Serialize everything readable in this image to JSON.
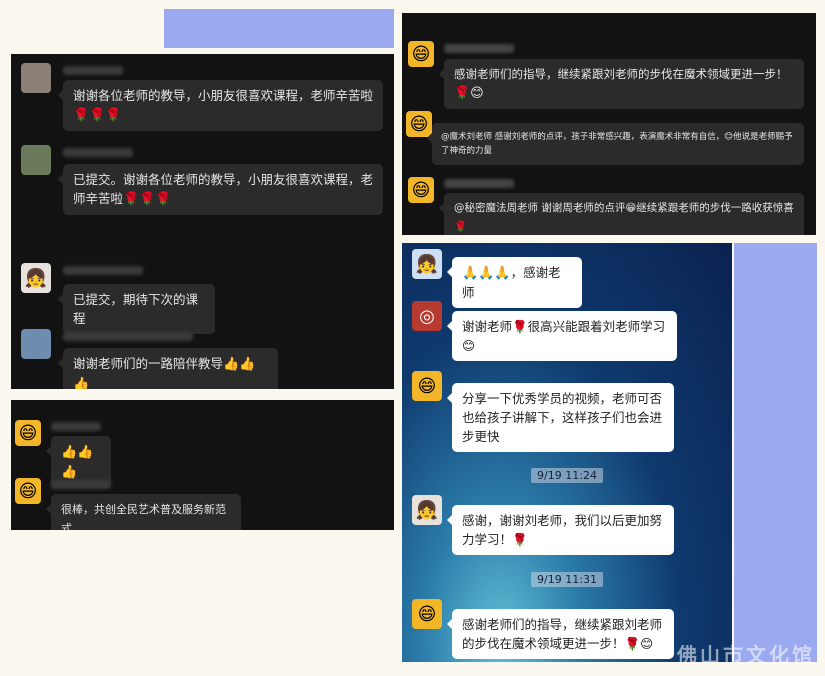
{
  "icons": {
    "rose": "🌹",
    "thumb": "👍",
    "smile": "😊",
    "grin": "😁",
    "clap": "🙏",
    "person": "👧",
    "cartoon": "😄"
  },
  "panel1": {
    "messages": [
      {
        "text": "谢谢各位老师的教导，小朋友很喜欢课程，老师辛苦啦",
        "emoji": "🌹🌹🌹"
      },
      {
        "text": "已提交。谢谢各位老师的教导，小朋友很喜欢课程，老师辛苦啦",
        "emoji": "🌹🌹🌹"
      },
      {
        "text": "已提交，期待下次的课程",
        "emoji": ""
      },
      {
        "text": "谢谢老师们的一路陪伴教导",
        "emoji": "👍👍👍"
      }
    ]
  },
  "panel2": {
    "messages": [
      {
        "text": "",
        "emoji": "👍👍👍"
      },
      {
        "text": "很棒，共创全民艺术普及服务新范式",
        "emoji": ""
      }
    ]
  },
  "panel3": {
    "messages": [
      {
        "text": "感谢老师们的指导，继续紧跟刘老师的步伐在魔术领域更进一步！",
        "emoji": "🌹😊"
      },
      {
        "text": "@魔术刘老师 感谢刘老师的点评，孩子非常感兴趣，表演魔术非常有自信，",
        "emoji": "😊",
        "tail": "他说是老师赐予了神奇的力量"
      },
      {
        "text": "@秘密魔法周老师 谢谢周老师的点评",
        "emoji": "😁",
        "tail": "继续紧跟老师的步伐一路收获惊喜",
        "emoji2": "🌹"
      }
    ]
  },
  "panel4": {
    "messages": [
      {
        "text": "，感谢老师",
        "emoji": "🙏🙏🙏"
      },
      {
        "text": "谢谢老师",
        "emoji": "🌹",
        "tail": "很高兴能跟着刘老师学习",
        "emoji2": "😊"
      },
      {
        "text": "分享一下优秀学员的视频，老师可否也给孩子讲解下，这样孩子们也会进步更快"
      },
      {
        "text": "感谢，谢谢刘老师，我们以后更加努力学习！",
        "emoji": "🌹"
      },
      {
        "text": "感谢老师们的指导，继续紧跟刘老师的步伐在魔术领域更进一步！",
        "emoji": "🌹😊"
      }
    ],
    "timestamps": [
      "9/19 11:24",
      "9/19 11:31"
    ],
    "watermark": "佛山市文化馆"
  }
}
